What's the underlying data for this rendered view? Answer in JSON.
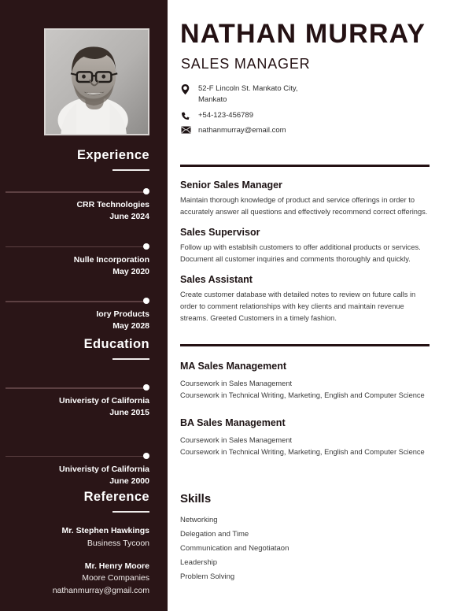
{
  "header": {
    "name": "NATHAN MURRAY",
    "role": "SALES MANAGER",
    "contact": [
      {
        "icon": "location-pin-icon",
        "line1": "52-F Lincoln St. Mankato City,",
        "line2": "Mankato"
      },
      {
        "icon": "phone-icon",
        "line1": "+54-123-456789",
        "line2": ""
      },
      {
        "icon": "envelope-icon",
        "line1": "nathanmurray@email.com",
        "line2": ""
      }
    ]
  },
  "sidebar": {
    "photo_alt": "profile-photo",
    "experience": {
      "heading": "Experience",
      "entries": [
        {
          "org": "CRR Technologies",
          "date": "June 2024"
        },
        {
          "org": "Nulle Incorporation",
          "date": "May 2020"
        },
        {
          "org": "Iory Products",
          "date": "May 2028"
        }
      ]
    },
    "education": {
      "heading": "Education",
      "entries": [
        {
          "org": "Univeristy of California",
          "date": "June 2015"
        },
        {
          "org": "Univeristy of California",
          "date": "June 2000"
        }
      ]
    },
    "reference": {
      "heading": "Reference",
      "entries": [
        {
          "name": "Mr. Stephen Hawkings",
          "detail1": "Business Tycoon",
          "detail2": ""
        },
        {
          "name": "Mr. Henry Moore",
          "detail1": "Moore Companies",
          "detail2": "nathanmurray@gmail.com"
        }
      ]
    }
  },
  "main": {
    "experience_items": [
      {
        "title": "Senior Sales Manager",
        "body": "Maintain thorough knowledge of product and service offerings in order to accurately answer all questions and effectively recommend correct offerings."
      },
      {
        "title": "Sales Supervisor",
        "body": "Follow up with establsih customers to offer additional products or services. Document all customer inquiries and comments thoroughly and quickly."
      },
      {
        "title": "Sales Assistant",
        "body": "Create customer database with detailed notes to review on future calls in order to comment relationships with key clients and maintain revenue streams. Greeted Customers in a timely fashion."
      }
    ],
    "education_items": [
      {
        "title": "MA Sales Management",
        "line1": "Coursework in Sales Management",
        "line2": "Coursework in Technical Writing, Marketing, English and Computer Science"
      },
      {
        "title": "BA Sales Management",
        "line1": "Coursework in Sales Management",
        "line2": "Coursework in Technical Writing, Marketing, English and Computer Science"
      }
    ],
    "skills": {
      "title": "Skills",
      "items": [
        "Networking",
        "Delegation and Time",
        "Communication and Negotiataon",
        "Leadership",
        "Problem Solving"
      ]
    }
  },
  "colors": {
    "sidebar_bg": "#2a1517",
    "ink": "#241113",
    "body_text": "#3a3a3a",
    "timeline_line": "#5c4042"
  }
}
